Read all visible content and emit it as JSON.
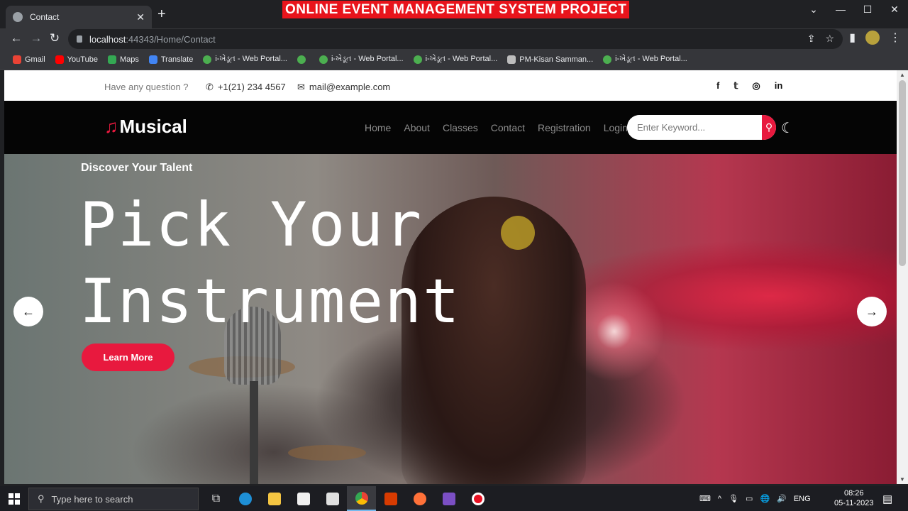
{
  "browser": {
    "tab_title": "Contact",
    "banner": "ONLINE EVENT MANAGEMENT SYSTEM PROJECT",
    "url_host": "localhost",
    "url_rest": ":44343/Home/Contact",
    "bookmarks": [
      {
        "label": "Gmail",
        "color": "#ea4335"
      },
      {
        "label": "YouTube",
        "color": "#ff0000"
      },
      {
        "label": "Maps",
        "color": "#34a853"
      },
      {
        "label": "Translate",
        "color": "#4285f4"
      },
      {
        "label": "i-ખેડૂત - Web Portal...",
        "color": "#4caf50"
      },
      {
        "label": "",
        "color": "#4caf50"
      },
      {
        "label": "i-ખેડૂત - Web Portal...",
        "color": "#4caf50"
      },
      {
        "label": "i-ખેડૂત - Web Portal...",
        "color": "#4caf50"
      },
      {
        "label": "PM-Kisan Samman...",
        "color": "#bdbdbd"
      },
      {
        "label": "i-ખેડૂત - Web Portal...",
        "color": "#4caf50"
      }
    ]
  },
  "site": {
    "topbar": {
      "question": "Have any question ?",
      "phone": "+1(21) 234 4567",
      "email": "mail@example.com"
    },
    "logo": "Musical",
    "menu": [
      "Home",
      "About",
      "Classes",
      "Contact",
      "Registration",
      "Login"
    ],
    "search_placeholder": "Enter Keyword...",
    "hero": {
      "subtitle": "Discover Your Talent",
      "headline_line1": "Pick Your",
      "headline_line2": "Instrument",
      "button": "Learn More"
    },
    "accent_color": "#e8193e"
  },
  "taskbar": {
    "search_placeholder": "Type here to search",
    "lang": "ENG",
    "time": "08:26",
    "date": "05-11-2023"
  }
}
